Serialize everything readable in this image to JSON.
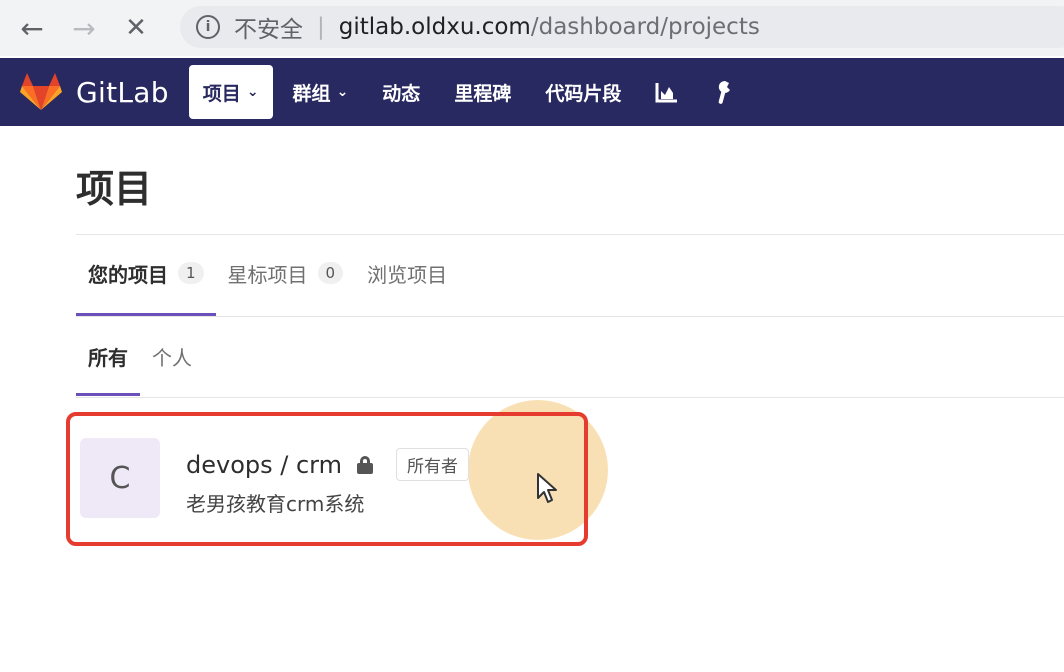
{
  "browser": {
    "back_icon": "back-arrow-icon",
    "forward_icon": "forward-arrow-icon",
    "stop_icon": "close-icon",
    "security_label": "不安全",
    "url_host": "gitlab.oldxu.com",
    "url_path": "/dashboard/projects"
  },
  "navbar": {
    "brand": "GitLab",
    "items": [
      {
        "label": "项目",
        "has_dropdown": true,
        "active": true
      },
      {
        "label": "群组",
        "has_dropdown": true,
        "active": false
      },
      {
        "label": "动态",
        "has_dropdown": false,
        "active": false
      },
      {
        "label": "里程碑",
        "has_dropdown": false,
        "active": false
      },
      {
        "label": "代码片段",
        "has_dropdown": false,
        "active": false
      }
    ],
    "chart_icon": "chart-icon",
    "admin_icon": "wrench-icon",
    "bg_color": "#292961"
  },
  "page": {
    "title": "项目",
    "tabs": [
      {
        "label": "您的项目",
        "count": "1",
        "active": true
      },
      {
        "label": "星标项目",
        "count": "0",
        "active": false
      },
      {
        "label": "浏览项目",
        "count": "",
        "active": false
      }
    ],
    "subtabs": [
      {
        "label": "所有",
        "active": true
      },
      {
        "label": "个人",
        "active": false
      }
    ]
  },
  "projects": [
    {
      "avatar_letter": "C",
      "name": "devops / crm",
      "visibility_icon": "lock-icon",
      "role_badge": "所有者",
      "description": "老男孩教育crm系统"
    }
  ],
  "colors": {
    "accent": "#6b4fbb",
    "highlight_border": "#e53c2f"
  }
}
